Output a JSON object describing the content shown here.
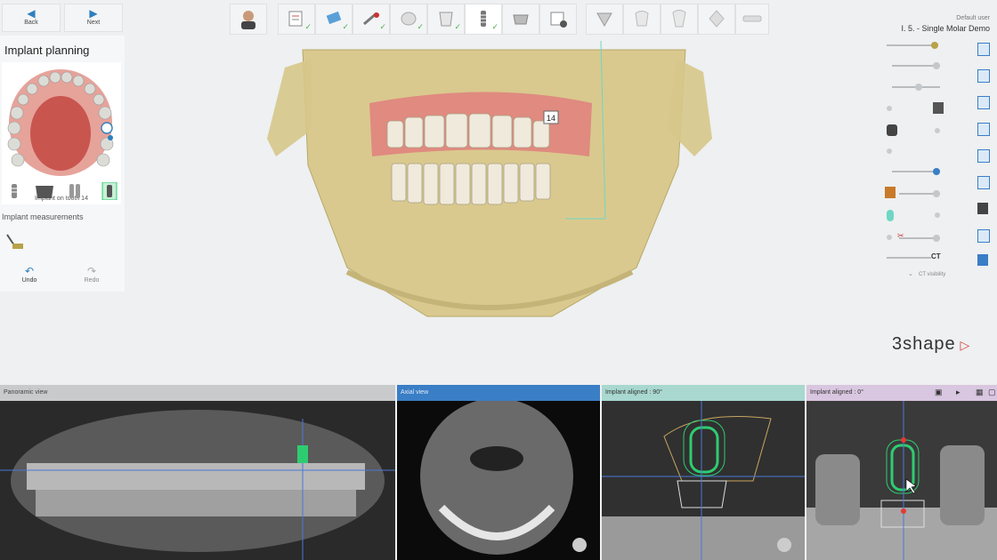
{
  "nav": {
    "back_label": "Back",
    "next_label": "Next"
  },
  "user": {
    "role": "Default user",
    "case_name": "I. 5. - Single Molar Demo"
  },
  "left_panel": {
    "title": "Implant planning",
    "jaw_caption": "Implant on tooth 14",
    "measurements_label": "Implant measurements",
    "undo_label": "Undo",
    "redo_label": "Redo"
  },
  "tooth_marker": "14",
  "ct_visibility_label": "CT visibility",
  "ct_label": "CT",
  "brand": "3shape",
  "panes": [
    {
      "title": "Panoramic view"
    },
    {
      "title": "Axial view"
    },
    {
      "title": "Implant aligned : 90°"
    },
    {
      "title": "Implant aligned : 0°"
    }
  ],
  "colors": {
    "accent": "#2f7fbf",
    "bone": "#d9c98e",
    "gum": "#d97f72",
    "implant_green": "#2ecc71",
    "axial_header": "#3a7ec6",
    "aligned90_header": "#a8d8cf",
    "aligned0_header": "#d9c6e0"
  }
}
